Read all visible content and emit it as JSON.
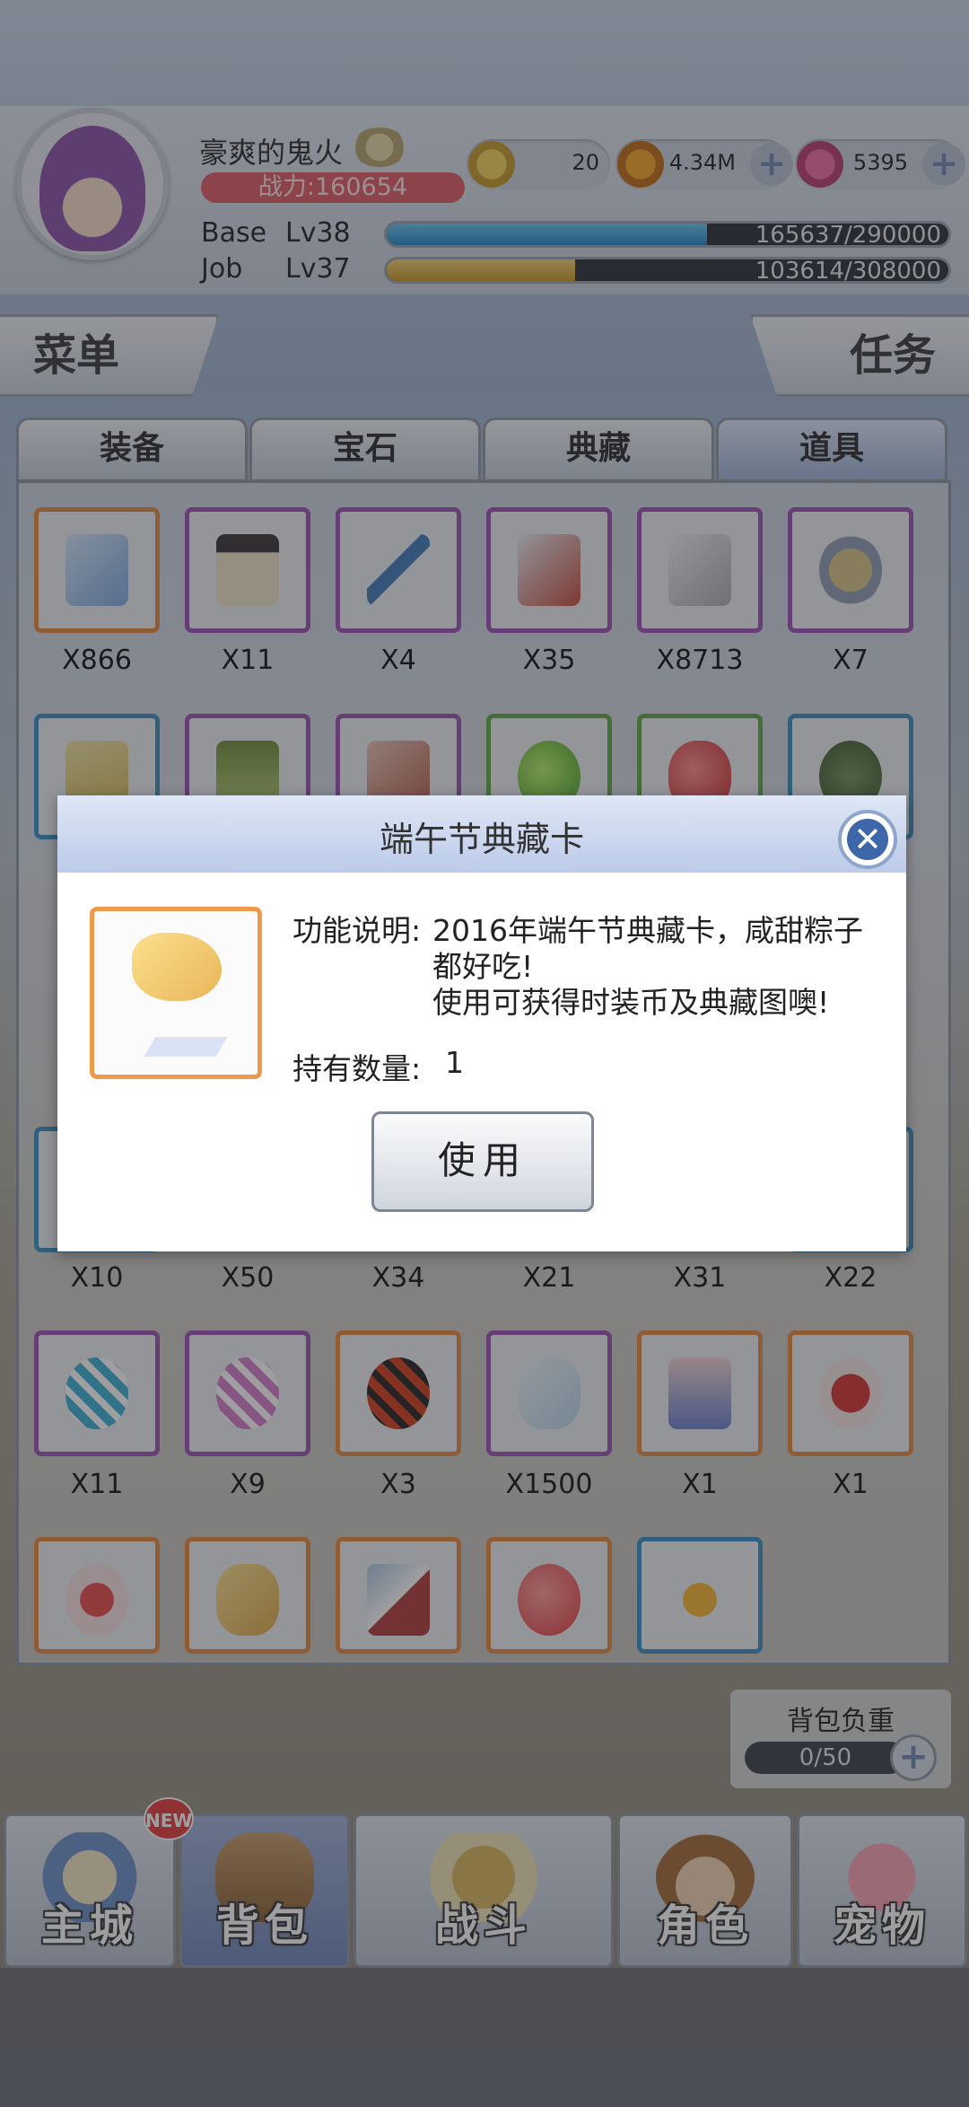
{
  "player": {
    "name": "豪爽的鬼火",
    "power_label": "战力:160654",
    "base_label": "Base",
    "base_level": "Lv38",
    "base_exp": "165637/290000",
    "base_exp_progress": 0.571,
    "job_label": "Job",
    "job_level": "Lv37",
    "job_exp": "103614/308000",
    "job_exp_progress": 0.336
  },
  "currencies": [
    {
      "icon": "zeny-coin-icon",
      "value": "20"
    },
    {
      "icon": "gold-coin-icon",
      "value": "4.34M"
    },
    {
      "icon": "gem-icon",
      "value": "5395"
    }
  ],
  "buttons": {
    "menu": "菜单",
    "task": "任务"
  },
  "tabs": [
    "装备",
    "宝石",
    "典藏",
    "道具"
  ],
  "active_tab": "道具",
  "inventory": {
    "row1": [
      "X866",
      "X11",
      "X4",
      "X35",
      "X8713",
      "X7"
    ],
    "row4": [
      "X10",
      "X50",
      "X34",
      "X21",
      "X31",
      "X22"
    ],
    "row5": [
      "X11",
      "X9",
      "X3",
      "X1500",
      "X1",
      "X1"
    ]
  },
  "dialog": {
    "title": "端午节典藏卡",
    "desc_label": "功能说明:",
    "desc_line1": "2016年端午节典藏卡，咸甜粽子",
    "desc_line2": "都好吃!",
    "desc_line3": "使用可获得时装币及典藏图噢!",
    "owned_label": "持有数量:",
    "owned_value": "1",
    "use_button": "使用"
  },
  "weight": {
    "label": "背包负重",
    "value": "0/50"
  },
  "nav": [
    {
      "label": "主城",
      "badge": "NEW"
    },
    {
      "label": "背包"
    },
    {
      "label": "战斗"
    },
    {
      "label": "角色"
    },
    {
      "label": "宠物"
    }
  ],
  "colors": {
    "power_bg": "#e05a63",
    "base_bar": "#2f9ad6",
    "job_bar": "#d9a93a",
    "rarity_orange": "#e4893c",
    "rarity_purple": "#9b4fb3",
    "rarity_blue": "#3a8fc2",
    "rarity_green": "#5ba640"
  }
}
